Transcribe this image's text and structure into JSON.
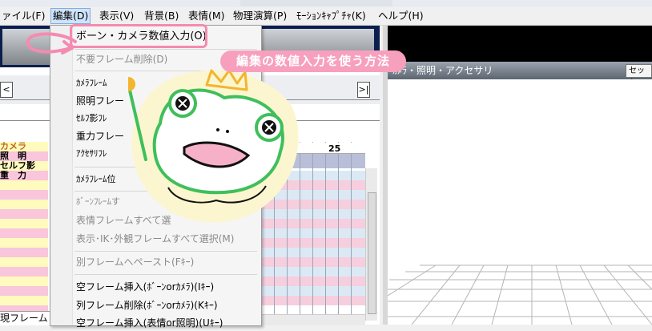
{
  "menubar": {
    "items": [
      {
        "label": "ァイル(F)"
      },
      {
        "label": "編集(D)"
      },
      {
        "label": "表示(V)"
      },
      {
        "label": "背景(B)"
      },
      {
        "label": "表情(M)"
      },
      {
        "label": "物理演算(P)"
      },
      {
        "label": "ﾓｰｼｮﾝｷｬﾌﾟﾁｬ(K)"
      },
      {
        "label": "ヘルプ(H)"
      }
    ]
  },
  "edit_menu": {
    "items": [
      {
        "label": "ボーン・カメラ数値入力(O)",
        "enabled": true
      },
      {
        "label": "不要フレーム削除(D)",
        "enabled": false
      },
      {
        "label": "ｶﾒﾗﾌﾚｰﾑ",
        "enabled": true
      },
      {
        "label": "照明フレー",
        "enabled": true
      },
      {
        "label": "ｾﾙﾌ影ﾌﾚ",
        "enabled": true
      },
      {
        "label": "重力フレー",
        "enabled": true
      },
      {
        "label": "ｱｸｾｻﾘﾌﾚ",
        "enabled": true
      },
      {
        "label": "ｶﾒﾗﾌﾚｰﾑ位",
        "enabled": true
      },
      {
        "label": "ﾎﾞｰﾝﾌﾚｰﾑす",
        "enabled": false
      },
      {
        "label": "表情フレームすべて選",
        "enabled": false
      },
      {
        "label": "表示･IK･外観フレームすべて選択(M)",
        "enabled": false
      },
      {
        "label": "別フレームへペースト(Fｷｰ)",
        "enabled": false
      },
      {
        "label": "空フレーム挿入(ﾎﾞｰﾝorｶﾒﾗ)(Iｷｰ)",
        "enabled": true
      },
      {
        "label": "列フレーム削除(ﾎﾞｰﾝorｶﾒﾗ)(Kｷｰ)",
        "enabled": true
      },
      {
        "label": "空フレーム挿入(表情or照明)(Uｷｰ)",
        "enabled": true
      }
    ]
  },
  "timeline": {
    "track_names": [
      "カメラ",
      "照　明",
      "セルフ影",
      "重　力"
    ],
    "frame_label": "25",
    "current_frame_label": "現フレーム"
  },
  "camera_panel": {
    "title": "ｶﾒﾗ・照明・アクセサリ",
    "set_button": "セット"
  },
  "annotation": {
    "callout": "編集の数値入力を使う方法"
  },
  "colors": {
    "highlight_pink": "#f58bb0",
    "callout_pink": "#f7a0bd",
    "frog_green": "#3fbf5b",
    "menu_active": "#cfe4fa",
    "panel_navy": "#0c1e4e"
  }
}
